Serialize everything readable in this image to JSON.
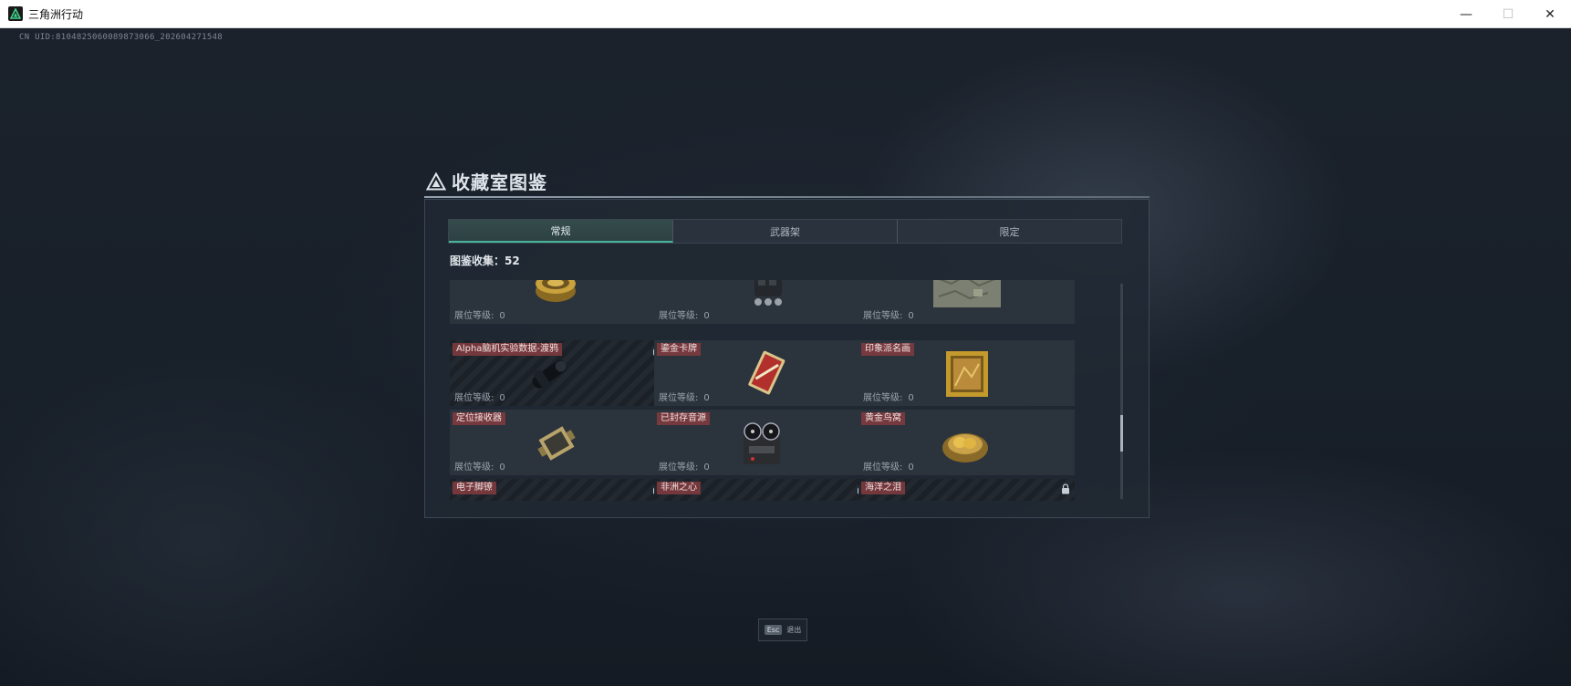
{
  "window": {
    "title": "三角洲行动",
    "controls": {
      "minimize": "—",
      "maximize": "☐",
      "close": "✕"
    }
  },
  "uid": "CN UID:8104825060089873066_202604271548",
  "panel": {
    "title": "收藏室图鉴",
    "tabs": [
      {
        "label": "常规",
        "active": true
      },
      {
        "label": "武器架",
        "active": false
      },
      {
        "label": "限定",
        "active": false
      }
    ],
    "collect_label": "图鉴收集：",
    "collect_value": "52",
    "level_label": "展位等级:",
    "items": [
      {
        "name": "",
        "level": "0",
        "locked": false,
        "icon": "gold-canister-icon",
        "row": 0,
        "col": 0
      },
      {
        "name": "",
        "level": "0",
        "locked": false,
        "icon": "black-device-icon",
        "row": 0,
        "col": 1
      },
      {
        "name": "",
        "level": "0",
        "locked": false,
        "icon": "map-icon",
        "row": 0,
        "col": 2
      },
      {
        "name": "Alpha脑机实验数据-渡鸦",
        "level": "0",
        "locked": true,
        "icon": "scope-device-icon",
        "row": 1,
        "col": 0
      },
      {
        "name": "鎏金卡牌",
        "level": "0",
        "locked": false,
        "icon": "gold-card-icon",
        "row": 1,
        "col": 1
      },
      {
        "name": "印象派名画",
        "level": "0",
        "locked": false,
        "icon": "gold-frame-painting-icon",
        "row": 1,
        "col": 2
      },
      {
        "name": "定位接收器",
        "level": "0",
        "locked": false,
        "icon": "gps-receiver-icon",
        "row": 2,
        "col": 0
      },
      {
        "name": "已封存音源",
        "level": "0",
        "locked": false,
        "icon": "reel-recorder-icon",
        "row": 2,
        "col": 1
      },
      {
        "name": "黄金鸟窝",
        "level": "0",
        "locked": false,
        "icon": "golden-nest-icon",
        "row": 2,
        "col": 2
      },
      {
        "name": "电子脚镣",
        "level": "",
        "locked": true,
        "icon": "ankle-monitor-icon",
        "row": 3,
        "col": 0
      },
      {
        "name": "非洲之心",
        "level": "",
        "locked": true,
        "icon": "gem-icon",
        "row": 3,
        "col": 1
      },
      {
        "name": "海洋之泪",
        "level": "",
        "locked": true,
        "icon": "gem-icon",
        "row": 3,
        "col": 2
      }
    ]
  },
  "esc": {
    "key": "Esc",
    "label": "退出"
  },
  "colors": {
    "accent": "#48b39a",
    "name_tag": "#7e3a3e",
    "background": "#18202a"
  }
}
